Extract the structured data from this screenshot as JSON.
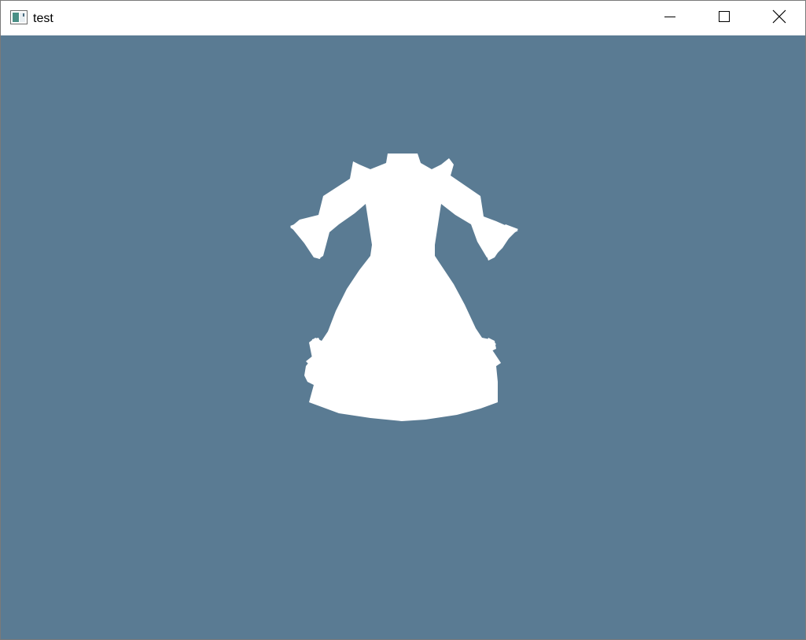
{
  "window": {
    "title": "test",
    "background_color": "#5a7b93",
    "app_icon": "app-window-icon",
    "controls": {
      "minimize_icon": "minimize-icon",
      "maximize_icon": "maximize-icon",
      "close_icon": "close-icon"
    }
  },
  "scene": {
    "object": "dress-silhouette",
    "fill_color": "#ffffff"
  }
}
